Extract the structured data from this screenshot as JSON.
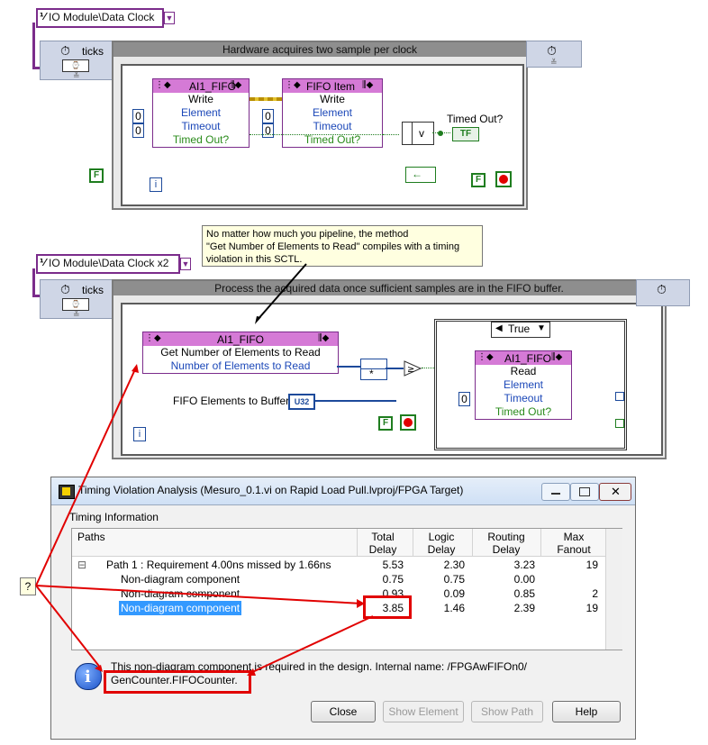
{
  "top": {
    "clock_control_label": "IO Module\\Data Clock",
    "ticks_label": "ticks",
    "loop_header_title": "Hardware acquires two sample per clock",
    "node1": {
      "title": "AI1_FIFO",
      "method": "Write",
      "row_element": "Element",
      "row_timeout": "Timeout",
      "row_timed_out": "Timed Out?"
    },
    "node2": {
      "title": "FIFO Item",
      "method": "Write",
      "row_element": "Element",
      "row_timeout": "Timeout",
      "row_timed_out": "Timed Out?"
    },
    "const_zero": "0",
    "timed_out_label": "Timed Out?",
    "indicator_tf": "TF",
    "iter_i": "i",
    "bool_F": "F"
  },
  "callout": {
    "lines": [
      "No matter how much you pipeline, the method",
      "\"Get Number of Elements to Read\" compiles with a timing",
      "violation in this SCTL."
    ]
  },
  "bottom": {
    "clock_control_label": "IO Module\\Data Clock x2",
    "ticks_label": "ticks",
    "loop_header_title": "Process the acquired data once sufficient samples are in the FIFO buffer.",
    "node_left": {
      "title": "AI1_FIFO",
      "row_method": "Get Number of Elements to Read",
      "row_out": "Number of Elements to Read"
    },
    "fifo_elements_to_buffer_label": "FIFO Elements to Buffer",
    "u32_tag": "U32",
    "case_selector": "True",
    "node_case": {
      "title": "AI1_FIFO",
      "method": "Read",
      "row_element": "Element",
      "row_timeout": "Timeout",
      "row_timed_out": "Timed Out?"
    },
    "const_zero": "0",
    "iter_i": "i",
    "bool_F": "F"
  },
  "dialog": {
    "title": "Timing Violation Analysis (Mesuro_0.1.vi on Rapid Load Pull.lvproj/FPGA Target)",
    "section_label": "Timing Information",
    "columns": {
      "paths": "Paths",
      "total_delay": [
        "Total",
        "Delay"
      ],
      "logic_delay": [
        "Logic",
        "Delay"
      ],
      "routing_delay": [
        "Routing",
        "Delay"
      ],
      "max_fanout": [
        "Max",
        "Fanout"
      ]
    },
    "rows": [
      {
        "paths": "Path 1 : Requirement 4.00ns missed by 1.66ns",
        "total": "5.53",
        "logic": "2.30",
        "routing": "3.23",
        "fanout": "19",
        "indent": 1,
        "expander": "⊟"
      },
      {
        "paths": "Non-diagram component",
        "total": "0.75",
        "logic": "0.75",
        "routing": "0.00",
        "fanout": "",
        "indent": 2
      },
      {
        "paths": "Non-diagram component",
        "total": "0.93",
        "logic": "0.09",
        "routing": "0.85",
        "fanout": "2",
        "indent": 2
      },
      {
        "paths": "Non-diagram component",
        "total": "3.85",
        "logic": "1.46",
        "routing": "2.39",
        "fanout": "19",
        "indent": 2,
        "selected": true
      }
    ],
    "info_text_prefix": "This non-diagram compon",
    "info_text_rest": "ent is required in the design. Internal name: /FPGAwFIFOn0/",
    "info_text_line2": "GenCounter.FIFOCounter.",
    "buttons": {
      "close": "Close",
      "show_element": "Show Element",
      "show_path": "Show Path",
      "help": "Help"
    }
  },
  "question_mark": "?",
  "colors": {
    "red": "#e10000",
    "labview_purple": "#7b2c8b",
    "labview_blue": "#1d4a9b",
    "selection_blue": "#3399ff"
  }
}
